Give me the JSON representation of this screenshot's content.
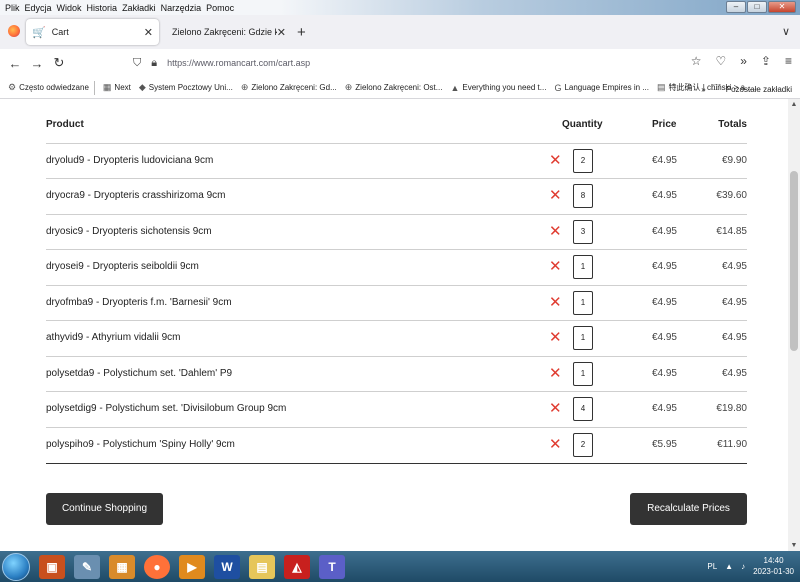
{
  "menu": [
    "Plik",
    "Edycja",
    "Widok",
    "Historia",
    "Zakładki",
    "Narzędzia",
    "Pomoc"
  ],
  "window_buttons": {
    "minimize": "–",
    "maximize": "□",
    "close": "✕"
  },
  "tabs": [
    {
      "title": "Cart",
      "close": "✕",
      "active": true
    },
    {
      "title": "Zielono Zakręceni: Gdzie kupować p",
      "close": "✕",
      "active": false
    }
  ],
  "new_tab": "+",
  "tabs_menu": "∨",
  "nav": {
    "back": "←",
    "forward": "→",
    "reload": "↻",
    "url": "https://www.romancart.com/cart.asp"
  },
  "bookmarks": [
    {
      "label": "Często odwiedzane",
      "icon": "gear-icon",
      "glyph": "⚙"
    },
    {
      "label": "Next",
      "icon": "grid-icon",
      "glyph": "▦"
    },
    {
      "label": "System Pocztowy Uni...",
      "icon": "mail-icon",
      "glyph": "◆"
    },
    {
      "label": "Zielono Zakręceni: Gd...",
      "icon": "globe-icon",
      "glyph": "⊕"
    },
    {
      "label": "Zielono Zakręceni: Ost...",
      "icon": "globe-icon",
      "glyph": "⊕"
    },
    {
      "label": "Everything you need t...",
      "icon": "triangle-icon",
      "glyph": "▲"
    },
    {
      "label": "Language Empires in ...",
      "icon": "google-icon",
      "glyph": "G"
    },
    {
      "label": "特此确认 | chiński > a...",
      "icon": "page-icon",
      "glyph": "▤"
    }
  ],
  "bookmarks_overflow": "»",
  "bookmarks_other": "Pozostałe zakładki",
  "cart": {
    "headers": {
      "product": "Product",
      "quantity": "Quantity",
      "price": "Price",
      "totals": "Totals"
    },
    "remove_glyph": "✕",
    "items": [
      {
        "name": "dryolud9 - Dryopteris ludoviciana 9cm",
        "qty": "2",
        "price": "€4.95",
        "total": "€9.90"
      },
      {
        "name": "dryocra9 - Dryopteris crasshirizoma 9cm",
        "qty": "8",
        "price": "€4.95",
        "total": "€39.60"
      },
      {
        "name": "dryosic9 - Dryopteris sichotensis 9cm",
        "qty": "3",
        "price": "€4.95",
        "total": "€14.85"
      },
      {
        "name": "dryosei9 - Dryopteris seiboldii 9cm",
        "qty": "1",
        "price": "€4.95",
        "total": "€4.95"
      },
      {
        "name": "dryofmba9 - Dryopteris f.m. 'Barnesii' 9cm",
        "qty": "1",
        "price": "€4.95",
        "total": "€4.95"
      },
      {
        "name": "athyvid9 - Athyrium vidalii 9cm",
        "qty": "1",
        "price": "€4.95",
        "total": "€4.95"
      },
      {
        "name": "polysetda9 - Polystichum set. 'Dahlem' P9",
        "qty": "1",
        "price": "€4.95",
        "total": "€4.95"
      },
      {
        "name": "polysetdig9 - Polystichum set. 'Divisilobum Group 9cm",
        "qty": "4",
        "price": "€4.95",
        "total": "€19.80"
      },
      {
        "name": "polyspiho9 - Polystichum 'Spiny Holly' 9cm",
        "qty": "2",
        "price": "€5.95",
        "total": "€11.90"
      }
    ],
    "continue_label": "Continue Shopping",
    "recalc_label": "Recalculate Prices"
  },
  "taskbar": {
    "apps": [
      {
        "name": "presentation-app-icon",
        "glyph": "▣",
        "color": "#c8501e"
      },
      {
        "name": "paint-app-icon",
        "glyph": "✎",
        "color": "#6a8fb0"
      },
      {
        "name": "screenshot-app-icon",
        "glyph": "▦",
        "color": "#d98b2b"
      },
      {
        "name": "firefox-taskbar-icon",
        "glyph": "●",
        "color": "#ff7139"
      },
      {
        "name": "media-player-icon",
        "glyph": "▶",
        "color": "#e08a1e"
      },
      {
        "name": "word-app-icon",
        "glyph": "W",
        "color": "#1e4fa1"
      },
      {
        "name": "file-explorer-icon",
        "glyph": "▤",
        "color": "#e6c65a"
      },
      {
        "name": "pdf-reader-icon",
        "glyph": "◭",
        "color": "#c8201e"
      },
      {
        "name": "teams-app-icon",
        "glyph": "T",
        "color": "#5b5fc7"
      }
    ],
    "lang": "PL",
    "time": "14:40",
    "date": "2023-01-30"
  }
}
